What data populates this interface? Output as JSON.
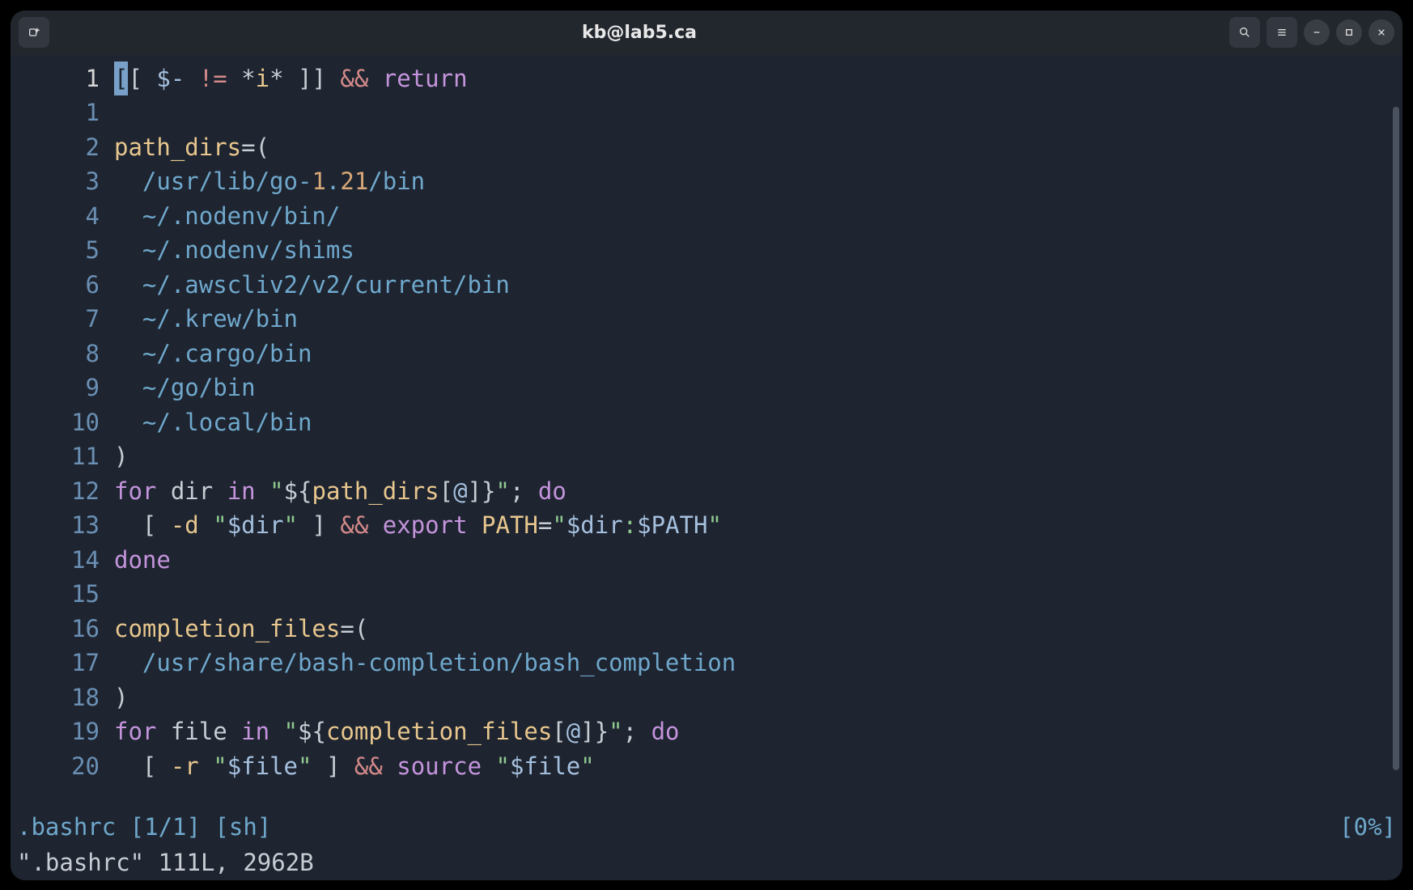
{
  "titlebar": {
    "title": "kb@lab5.ca"
  },
  "gutter": {
    "current": "1",
    "rel": [
      "1",
      "2",
      "3",
      "4",
      "5",
      "6",
      "7",
      "8",
      "9",
      "10",
      "11",
      "12",
      "13",
      "14",
      "15",
      "16",
      "17",
      "18",
      "19",
      "20"
    ]
  },
  "code": {
    "lines": [
      {
        "kind": "l1",
        "cursor": "[",
        "segs": [
          {
            "c": "tok-op",
            "t": "[ "
          },
          {
            "c": "tok-var",
            "t": "$-"
          },
          {
            "c": "tok-op",
            "t": " "
          },
          {
            "c": "tok-ne",
            "t": "!="
          },
          {
            "c": "tok-op",
            "t": " *"
          },
          {
            "c": "tok-id",
            "t": "i"
          },
          {
            "c": "tok-op",
            "t": "* ]] "
          },
          {
            "c": "tok-ne",
            "t": "&&"
          },
          {
            "c": "tok-op",
            "t": " "
          },
          {
            "c": "tok-kw",
            "t": "return"
          }
        ]
      },
      {
        "segs": []
      },
      {
        "segs": [
          {
            "c": "tok-id",
            "t": "path_dirs"
          },
          {
            "c": "tok-op",
            "t": "=("
          }
        ]
      },
      {
        "segs": [
          {
            "c": "tok-plain",
            "t": "  "
          },
          {
            "c": "tok-path",
            "t": "/usr/lib/go-"
          },
          {
            "c": "tok-num",
            "t": "1"
          },
          {
            "c": "tok-path",
            "t": "."
          },
          {
            "c": "tok-num",
            "t": "21"
          },
          {
            "c": "tok-path",
            "t": "/bin"
          }
        ]
      },
      {
        "segs": [
          {
            "c": "tok-plain",
            "t": "  "
          },
          {
            "c": "tok-path",
            "t": "~/.nodenv/bin/"
          }
        ]
      },
      {
        "segs": [
          {
            "c": "tok-plain",
            "t": "  "
          },
          {
            "c": "tok-path",
            "t": "~/.nodenv/shims"
          }
        ]
      },
      {
        "segs": [
          {
            "c": "tok-plain",
            "t": "  "
          },
          {
            "c": "tok-path",
            "t": "~/.awscliv2/v2/current/bin"
          }
        ]
      },
      {
        "segs": [
          {
            "c": "tok-plain",
            "t": "  "
          },
          {
            "c": "tok-path",
            "t": "~/.krew/bin"
          }
        ]
      },
      {
        "segs": [
          {
            "c": "tok-plain",
            "t": "  "
          },
          {
            "c": "tok-path",
            "t": "~/.cargo/bin"
          }
        ]
      },
      {
        "segs": [
          {
            "c": "tok-plain",
            "t": "  "
          },
          {
            "c": "tok-path",
            "t": "~/go/bin"
          }
        ]
      },
      {
        "segs": [
          {
            "c": "tok-plain",
            "t": "  "
          },
          {
            "c": "tok-path",
            "t": "~/.local/bin"
          }
        ]
      },
      {
        "segs": [
          {
            "c": "tok-op",
            "t": ")"
          }
        ]
      },
      {
        "segs": [
          {
            "c": "tok-kw",
            "t": "for"
          },
          {
            "c": "tok-plain",
            "t": " dir "
          },
          {
            "c": "tok-kw",
            "t": "in"
          },
          {
            "c": "tok-plain",
            "t": " "
          },
          {
            "c": "tok-str",
            "t": "\""
          },
          {
            "c": "tok-op",
            "t": "${"
          },
          {
            "c": "tok-id",
            "t": "path_dirs"
          },
          {
            "c": "tok-op",
            "t": "["
          },
          {
            "c": "tok-var",
            "t": "@"
          },
          {
            "c": "tok-op",
            "t": "]}"
          },
          {
            "c": "tok-str",
            "t": "\""
          },
          {
            "c": "tok-op",
            "t": ";"
          },
          {
            "c": "tok-plain",
            "t": " "
          },
          {
            "c": "tok-kw",
            "t": "do"
          }
        ]
      },
      {
        "segs": [
          {
            "c": "tok-plain",
            "t": "  "
          },
          {
            "c": "tok-op",
            "t": "[ "
          },
          {
            "c": "tok-id",
            "t": "-d"
          },
          {
            "c": "tok-op",
            "t": " "
          },
          {
            "c": "tok-str",
            "t": "\""
          },
          {
            "c": "tok-var",
            "t": "$dir"
          },
          {
            "c": "tok-str",
            "t": "\""
          },
          {
            "c": "tok-op",
            "t": " ] "
          },
          {
            "c": "tok-ne",
            "t": "&&"
          },
          {
            "c": "tok-plain",
            "t": " "
          },
          {
            "c": "tok-kw",
            "t": "export"
          },
          {
            "c": "tok-plain",
            "t": " "
          },
          {
            "c": "tok-id",
            "t": "PATH"
          },
          {
            "c": "tok-op",
            "t": "="
          },
          {
            "c": "tok-str",
            "t": "\""
          },
          {
            "c": "tok-var",
            "t": "$dir"
          },
          {
            "c": "tok-str",
            "t": ":"
          },
          {
            "c": "tok-var",
            "t": "$PATH"
          },
          {
            "c": "tok-str",
            "t": "\""
          }
        ]
      },
      {
        "segs": [
          {
            "c": "tok-kw",
            "t": "done"
          }
        ]
      },
      {
        "segs": []
      },
      {
        "segs": [
          {
            "c": "tok-id",
            "t": "completion_files"
          },
          {
            "c": "tok-op",
            "t": "=("
          }
        ]
      },
      {
        "segs": [
          {
            "c": "tok-plain",
            "t": "  "
          },
          {
            "c": "tok-path",
            "t": "/usr/share/bash-completion/bash_completion"
          }
        ]
      },
      {
        "segs": [
          {
            "c": "tok-op",
            "t": ")"
          }
        ]
      },
      {
        "segs": [
          {
            "c": "tok-kw",
            "t": "for"
          },
          {
            "c": "tok-plain",
            "t": " file "
          },
          {
            "c": "tok-kw",
            "t": "in"
          },
          {
            "c": "tok-plain",
            "t": " "
          },
          {
            "c": "tok-str",
            "t": "\""
          },
          {
            "c": "tok-op",
            "t": "${"
          },
          {
            "c": "tok-id",
            "t": "completion_files"
          },
          {
            "c": "tok-op",
            "t": "["
          },
          {
            "c": "tok-var",
            "t": "@"
          },
          {
            "c": "tok-op",
            "t": "]}"
          },
          {
            "c": "tok-str",
            "t": "\""
          },
          {
            "c": "tok-op",
            "t": ";"
          },
          {
            "c": "tok-plain",
            "t": " "
          },
          {
            "c": "tok-kw",
            "t": "do"
          }
        ]
      },
      {
        "segs": [
          {
            "c": "tok-plain",
            "t": "  "
          },
          {
            "c": "tok-op",
            "t": "[ "
          },
          {
            "c": "tok-id",
            "t": "-r"
          },
          {
            "c": "tok-op",
            "t": " "
          },
          {
            "c": "tok-str",
            "t": "\""
          },
          {
            "c": "tok-var",
            "t": "$file"
          },
          {
            "c": "tok-str",
            "t": "\""
          },
          {
            "c": "tok-op",
            "t": " ] "
          },
          {
            "c": "tok-ne",
            "t": "&&"
          },
          {
            "c": "tok-plain",
            "t": " "
          },
          {
            "c": "tok-kw",
            "t": "source"
          },
          {
            "c": "tok-plain",
            "t": " "
          },
          {
            "c": "tok-str",
            "t": "\""
          },
          {
            "c": "tok-var",
            "t": "$file"
          },
          {
            "c": "tok-str",
            "t": "\""
          }
        ]
      }
    ]
  },
  "statusbar": {
    "left": ".bashrc [1/1] [sh]",
    "right": "[0%]"
  },
  "cmdline": {
    "text": "\".bashrc\" 111L, 2962B"
  }
}
